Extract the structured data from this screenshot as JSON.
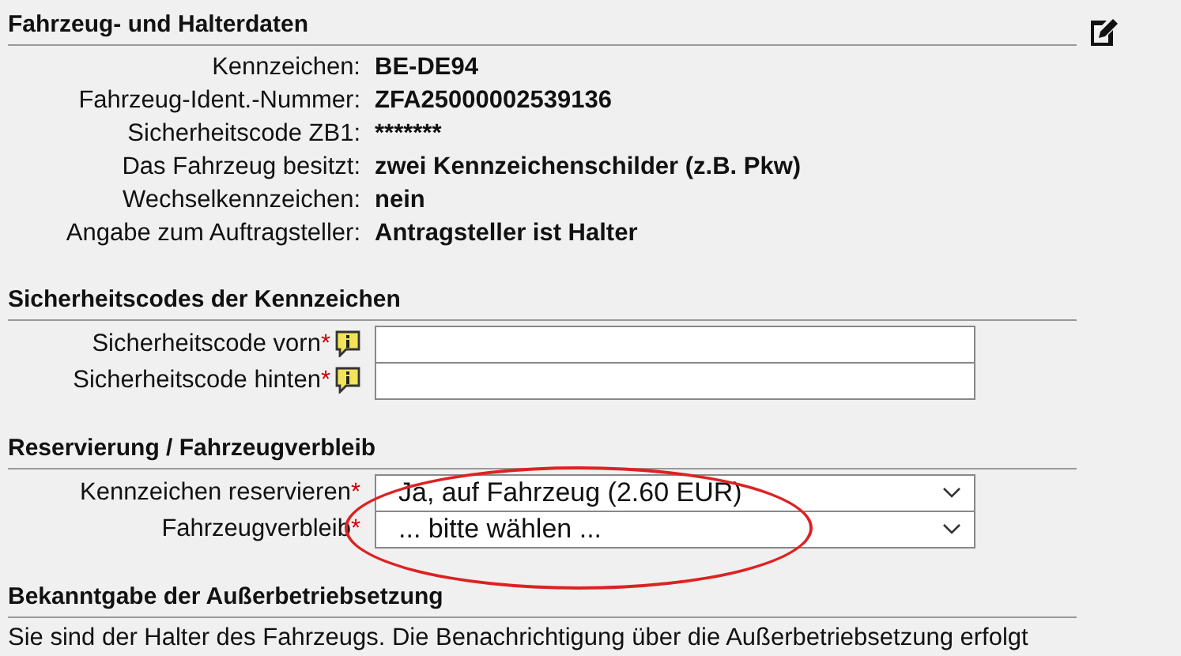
{
  "sections": [
    {
      "title": "Fahrzeug- und Halterdaten",
      "edit_icon": true,
      "rows": [
        {
          "kind": "value",
          "label": "Kennzeichen:",
          "value": "BE-DE94"
        },
        {
          "kind": "value",
          "label": "Fahrzeug-Ident.-Nummer:",
          "value": "ZFA25000002539136"
        },
        {
          "kind": "value",
          "label": "Sicherheitscode ZB1:",
          "value": "*******"
        },
        {
          "kind": "value",
          "label": "Das Fahrzeug besitzt:",
          "value": "zwei Kennzeichenschilder (z.B. Pkw)"
        },
        {
          "kind": "value",
          "label": "Wechselkennzeichen:",
          "value": "nein"
        },
        {
          "kind": "value",
          "label": "Angabe zum Auftragsteller:",
          "value": "Antragsteller ist Halter"
        }
      ]
    },
    {
      "title": "Sicherheitscodes der Kennzeichen",
      "rows": [
        {
          "kind": "input",
          "label": "Sicherheitscode vorn",
          "required": "*",
          "info": true
        },
        {
          "kind": "input",
          "label": "Sicherheitscode hinten",
          "required": "*",
          "info": true
        }
      ]
    },
    {
      "title": "Reservierung / Fahrzeugverbleib",
      "highlighted": true,
      "rows": [
        {
          "kind": "select",
          "label": "Kennzeichen reservieren",
          "required": "*",
          "value": "Ja, auf Fahrzeug (2.60 EUR)"
        },
        {
          "kind": "select",
          "label": "Fahrzeugverbleib",
          "required": "*",
          "value": "... bitte wählen ..."
        }
      ]
    },
    {
      "title": "Bekanntgabe der Außerbetriebsetzung",
      "text": "Sie sind der Halter des Fahrzeugs. Die Benachrichtigung über die Außerbetriebsetzung erfolgt"
    }
  ]
}
